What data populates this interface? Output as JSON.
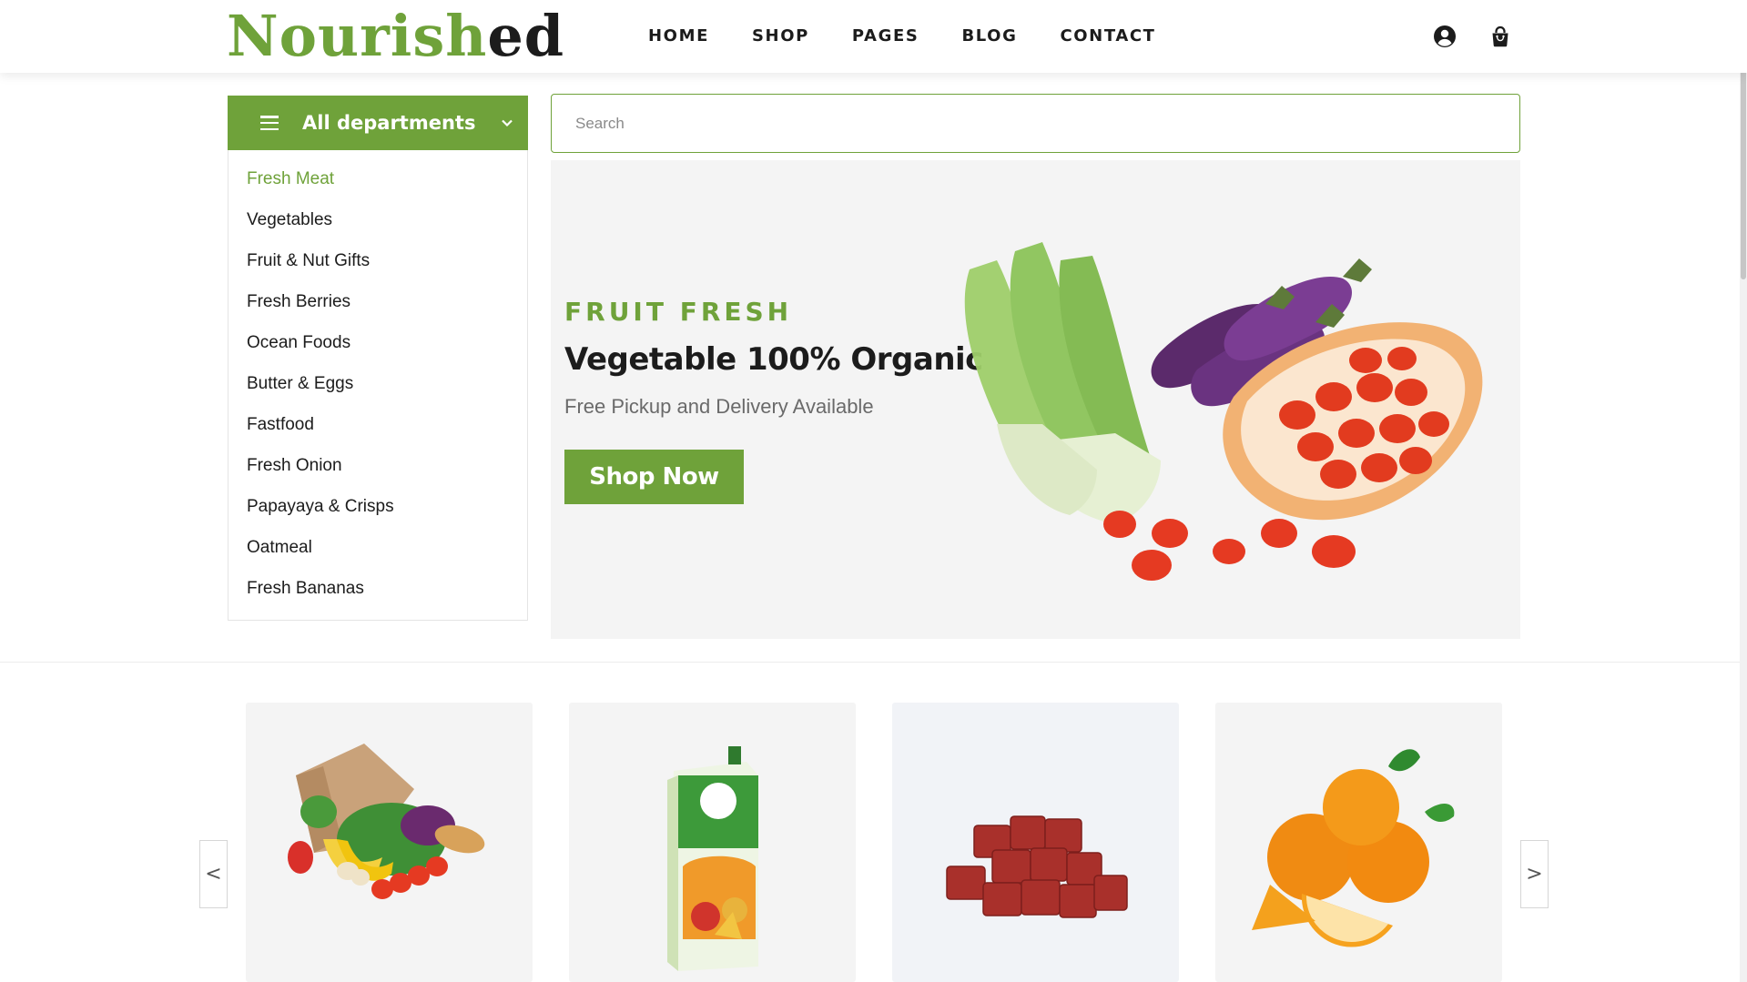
{
  "header": {
    "logo_part1": "Nourish",
    "logo_part2": "ed",
    "nav": [
      "HOME",
      "SHOP",
      "PAGES",
      "BLOG",
      "CONTACT"
    ],
    "icons": [
      "user-icon",
      "shopping-bag-icon"
    ]
  },
  "sidebar": {
    "title": "All departments",
    "items": [
      {
        "label": "Fresh Meat",
        "active": true
      },
      {
        "label": "Vegetables"
      },
      {
        "label": "Fruit & Nut Gifts"
      },
      {
        "label": "Fresh Berries"
      },
      {
        "label": "Ocean Foods"
      },
      {
        "label": "Butter & Eggs"
      },
      {
        "label": "Fastfood"
      },
      {
        "label": "Fresh Onion"
      },
      {
        "label": "Papayaya & Crisps"
      },
      {
        "label": "Oatmeal"
      },
      {
        "label": "Fresh Bananas"
      }
    ]
  },
  "search": {
    "placeholder": "Search"
  },
  "hero": {
    "kicker": "FRUIT FRESH",
    "title": "Vegetable 100% Organic",
    "subtitle": "Free Pickup and Delivery Available",
    "cta": "Shop Now"
  },
  "carousel": {
    "prev": "<",
    "next": ">",
    "cards": [
      "grocery-bag-image",
      "juice-carton-image",
      "raw-meat-image",
      "oranges-image"
    ]
  },
  "colors": {
    "accent": "#6fa23a",
    "text": "#1c1c1c",
    "muted": "#6a6a6a",
    "panel": "#f4f4f4"
  }
}
